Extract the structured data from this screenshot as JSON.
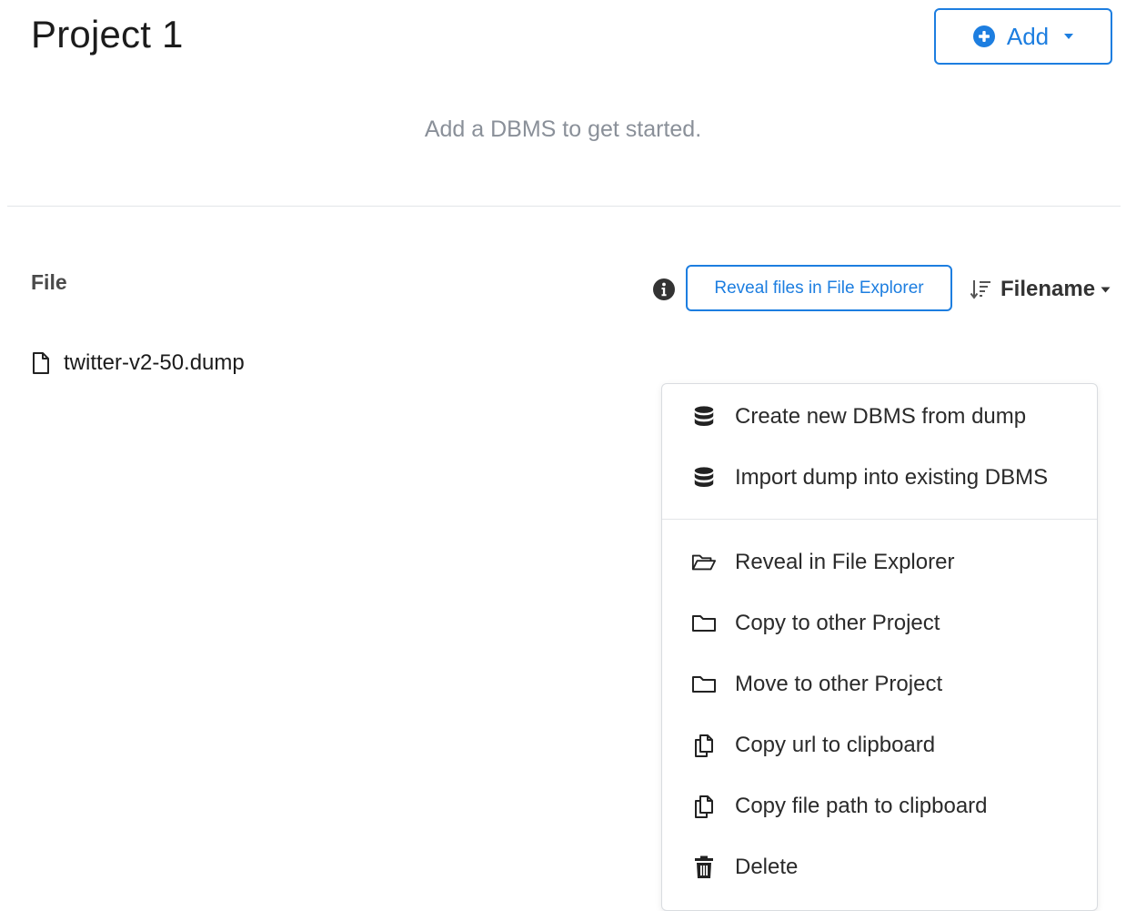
{
  "header": {
    "title": "Project 1",
    "add_label": "Add",
    "add_icon": "plus-circle-icon"
  },
  "empty_state": {
    "message": "Add a DBMS to get started."
  },
  "files_section": {
    "column_header": "File",
    "reveal_button_label": "Reveal files in File Explorer",
    "sort_label": "Filename",
    "files": [
      {
        "name": "twitter-v2-50.dump",
        "icon": "file-icon"
      }
    ]
  },
  "context_menu": {
    "items": [
      {
        "label": "Create new DBMS from dump",
        "icon": "database-icon"
      },
      {
        "label": "Import dump into existing DBMS",
        "icon": "database-icon"
      },
      {
        "label": "Reveal in File Explorer",
        "icon": "folder-open-icon"
      },
      {
        "label": "Copy to other Project",
        "icon": "folder-icon"
      },
      {
        "label": "Move to other Project",
        "icon": "folder-icon"
      },
      {
        "label": "Copy url to clipboard",
        "icon": "copy-icon"
      },
      {
        "label": "Copy file path to clipboard",
        "icon": "copy-icon"
      },
      {
        "label": "Delete",
        "icon": "trash-icon"
      }
    ]
  },
  "colors": {
    "accent": "#1d7ee0",
    "muted_text": "#8a9099",
    "divider": "#e3e5e8"
  }
}
